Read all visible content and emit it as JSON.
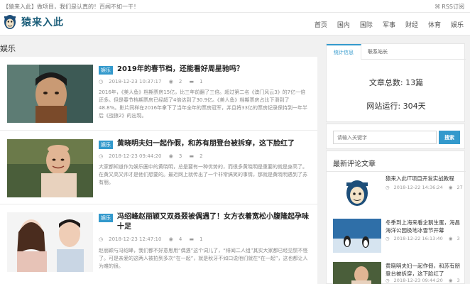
{
  "topbar": {
    "notice": "【猿来入此】做项目，我们是认真的！百闻不如一干！",
    "rss_label": "RSS订阅"
  },
  "header": {
    "logo_text": "猿来入此",
    "nav": [
      "首页",
      "国内",
      "国际",
      "军事",
      "财经",
      "体育",
      "娱乐"
    ]
  },
  "section": {
    "title": "娱乐"
  },
  "articles": [
    {
      "category": "娱乐",
      "title": "2019年的春节档，还能看好周星驰吗？",
      "date": "2018-12-23 10:37:17",
      "views": "2",
      "comments": "1",
      "excerpt": "2016年，《美人鱼》档期票房15亿，比三年前翻了三倍。超过第二名《澳门风云3》的7亿一倍还多。但是春节档期票房已经超了4倍达到了30.9亿。《美人鱼》档期票房占比下滑到了48.8%。影片同样在2016年拿下了当年全年的票房冠军，并且将33亿的票房纪录保持到一年半后《战狼2》的出现。"
    },
    {
      "category": "娱乐",
      "title": "黄晓明夫妇一起作假，和苏有朋登台被拆穿，这下脸红了",
      "date": "2018-12-23 09:44:20",
      "views": "3",
      "comments": "2",
      "excerpt": "大家都知道作为娱乐圈中的黄晓明，总是要有一种优势的，而很多黄晓明是重要的就是身高了。在黄又高又帅才是他们想要的。最近网上就传出了一个非常搞笑的事情，那就是黄晓明遇到了苏有朋。"
    },
    {
      "category": "娱乐",
      "title": "冯绍峰赵丽颖又双叒叕被偶遇了！女方衣着宽松小腹隆起孕味十足",
      "date": "2018-12-23 12:47:10",
      "views": "4",
      "comments": "1",
      "excerpt": "赵丽颖与冯绍峰，我们都不好意思用“偶遇”这个词儿了，“绯闻二人组”其实大家都已经见惯不怪了。可是亲爱的这两人被拍到多次“在一起”，就是秋牙不如口说他们就在“在一起”，这也都让人为难的很。"
    }
  ],
  "sidebar": {
    "tabs": [
      "统计信息",
      "联系站长"
    ],
    "stats": {
      "articles": "文章总数: 13篇",
      "uptime": "网站运行: 304天"
    },
    "search": {
      "placeholder": "请输入关键字",
      "button": "搜索"
    },
    "comments_title": "最新评论文章",
    "comments": [
      {
        "title": "猿来入此IT项目开发实战教程",
        "date": "2018-12-22 14:36:24",
        "views": "27"
      },
      {
        "title": "冬季到上海来看企鹅生蛋，海昌海洋公园极地冰雪节开幕",
        "date": "2018-12-22 16:13:40",
        "views": "3"
      },
      {
        "title": "黄晓明夫妇一起作假，和苏有朋登台被拆穿，这下脸红了",
        "date": "2018-12-23 09:44:20",
        "views": "3"
      }
    ]
  }
}
